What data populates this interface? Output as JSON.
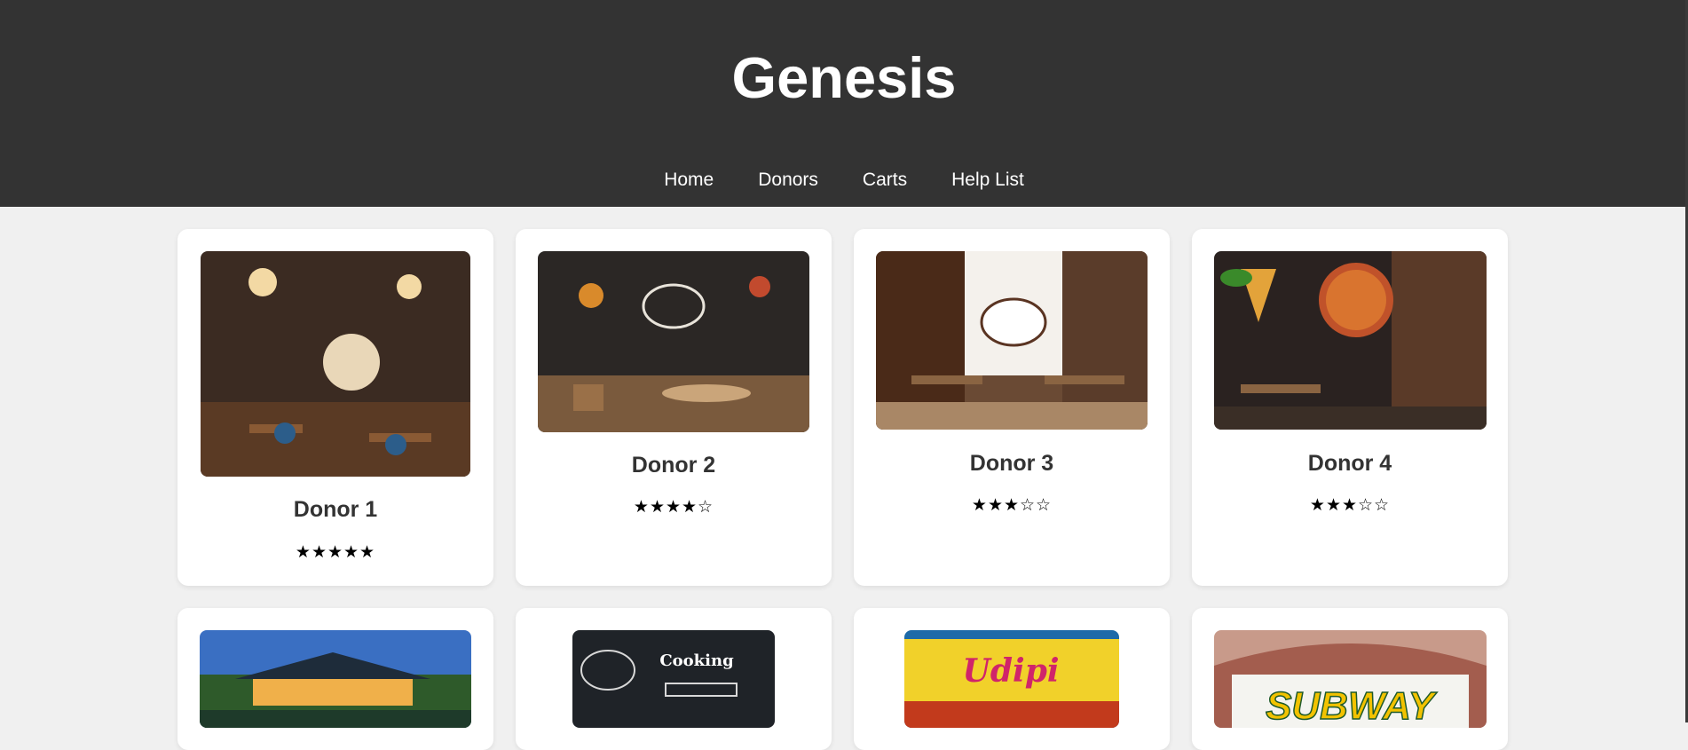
{
  "header": {
    "title": "Genesis"
  },
  "nav": [
    {
      "label": "Home"
    },
    {
      "label": "Donors"
    },
    {
      "label": "Carts"
    },
    {
      "label": "Help List"
    }
  ],
  "donors": [
    {
      "name": "Donor 1",
      "rating": "★★★★★",
      "stars": 5,
      "image": "coffee-house-image"
    },
    {
      "name": "Donor 2",
      "rating": "★★★★☆",
      "stars": 4,
      "image": "restaurant-menu-image"
    },
    {
      "name": "Donor 3",
      "rating": "★★★☆☆",
      "stars": 3,
      "image": "coffee-restaurant-image"
    },
    {
      "name": "Donor 4",
      "rating": "★★★☆☆",
      "stars": 3,
      "image": "pizza-restaurant-image"
    }
  ],
  "second_row_images": [
    {
      "name": "resort-restaurant-image",
      "text": ""
    },
    {
      "name": "cooking-chalkboard-image",
      "text": "Cooking"
    },
    {
      "name": "udipi-restaurant-image",
      "text": "Udipi"
    },
    {
      "name": "subway-store-image",
      "text": "SUBWAY"
    }
  ]
}
